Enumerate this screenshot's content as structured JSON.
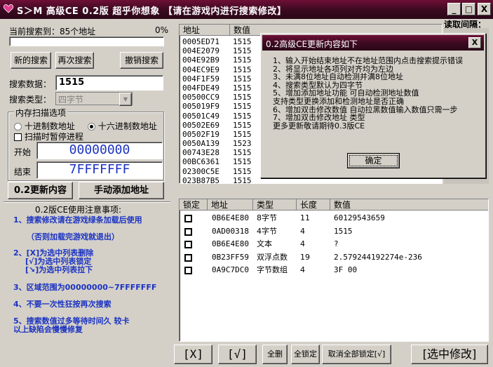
{
  "window": {
    "title": "S＞M 高级CE 0.2版 超乎你想象 【请在游戏内进行搜索修改】",
    "minimize": "_",
    "maximize": "□",
    "close": "X"
  },
  "search": {
    "status": "当前搜索到：85个地址",
    "progress_text": "0%",
    "progress": 0,
    "new_search": "新的搜索",
    "next_search": "再次搜索",
    "cancel_search": "撤销搜索",
    "data_label": "搜索数据：",
    "data_value": "1515",
    "type_label": "搜索类型：",
    "type_value": "四字节"
  },
  "scan": {
    "group_title": "内存扫描选项",
    "decimal": "十进制数地址",
    "hex": "十六进制数地址",
    "pause": "扫描时暂停进程",
    "start_label": "开始",
    "start_value": "00000000",
    "end_label": "结束",
    "end_value": "7FFFFFFF"
  },
  "actions": {
    "update": "0.2更新内容",
    "manual_add": "手动添加地址"
  },
  "notes": {
    "title": "0.2版CE使用注意事项:",
    "n1": "1、搜索修改请在游戏绿条加载后使用",
    "n1b": "（否则加载完游戏就退出）",
    "n2a": "2、[X]为选中列表删除",
    "n2b": "[√]为选中列表锁定",
    "n2c": "[↘]为选中列表拉下",
    "n3": "3、区域范围为00000000~7FFFFFFF",
    "n4": "4、不要一次性狂按再次搜索",
    "n5a": "5、搜索数值过多等待时间久  较卡",
    "n5b": "以上缺陷会慢慢修复"
  },
  "results": {
    "col_addr": "地址",
    "col_value": "数值",
    "rows": [
      {
        "addr": "0005ED71",
        "val": "1515"
      },
      {
        "addr": "004E2079",
        "val": "1515"
      },
      {
        "addr": "004E92B9",
        "val": "1515"
      },
      {
        "addr": "004EC9E9",
        "val": "1515"
      },
      {
        "addr": "004F1F59",
        "val": "1515"
      },
      {
        "addr": "004FDE49",
        "val": "1515"
      },
      {
        "addr": "00500CC9",
        "val": "1515"
      },
      {
        "addr": "005019F9",
        "val": "1515"
      },
      {
        "addr": "00501C49",
        "val": "1515"
      },
      {
        "addr": "00502E69",
        "val": "1515"
      },
      {
        "addr": "00502F19",
        "val": "1515"
      },
      {
        "addr": "0050A139",
        "val": "1523"
      },
      {
        "addr": "00743E28",
        "val": "1515"
      },
      {
        "addr": "00BC6361",
        "val": "1515"
      },
      {
        "addr": "02300C5E",
        "val": "1515"
      },
      {
        "addr": "023B87B5",
        "val": "1515"
      }
    ]
  },
  "right_panel": {
    "label": "读取间隔："
  },
  "locked": {
    "col_lock": "锁定",
    "col_addr": "地址",
    "col_type": "类型",
    "col_len": "长度",
    "col_value": "数值",
    "rows": [
      {
        "addr": "0B6E4E80",
        "type": "8字节",
        "len": "11",
        "value": "60129543659"
      },
      {
        "addr": "0AD00318",
        "type": "4字节",
        "len": "4",
        "value": "1515"
      },
      {
        "addr": "0B6E4E80",
        "type": "文本",
        "len": "4",
        "value": "?"
      },
      {
        "addr": "0B23FF59",
        "type": "双浮点数",
        "len": "19",
        "value": "2.579244192274e-236"
      },
      {
        "addr": "0A9C7DC0",
        "type": "字节数组",
        "len": "4",
        "value": "3F 00"
      }
    ]
  },
  "bottom": {
    "del": "[X]",
    "lock": "[√]",
    "delete_all": "全删",
    "lock_all": "全锁定",
    "unlock_all": "取消全部锁定[√]",
    "edit_selected": "[选中修改]"
  },
  "dialog": {
    "title": "0.2高级CE更新内容如下",
    "close": "X",
    "lines": [
      "1、输入开始结束地址不在地址范围内点击搜索提示错误",
      "2、将显示地址各项列对齐均为左边",
      "3、未满8位地址自动检测并满8位地址",
      "4、搜索类型默认为四字节",
      "5、增加添加地址功能 可自动检测地址数值",
      "支持类型更换添加和检测地址是否正确",
      "6、增加双击修改数值 自动拉黑数值输入数值只需一步",
      "7、增加双击修改地址 类型",
      "更多更新敬请期待0.3版CE"
    ],
    "ok": "确定"
  }
}
